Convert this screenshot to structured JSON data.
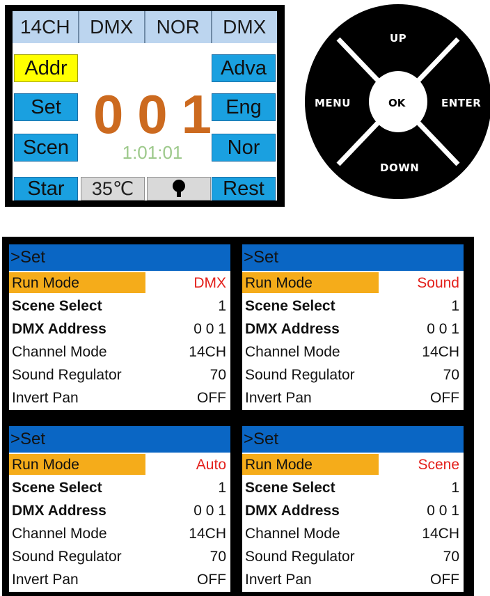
{
  "main_display": {
    "header": [
      "14CH",
      "DMX",
      "NOR",
      "DMX"
    ],
    "left_buttons": [
      "Addr",
      "Set",
      "Scen",
      "Star"
    ],
    "right_buttons": [
      "Adva",
      "Eng",
      "Nor",
      "Rest"
    ],
    "address_digits": [
      "0",
      "0",
      "1"
    ],
    "timer": "1:01:01",
    "temperature": "35℃",
    "lamp_icon": "lamp-icon"
  },
  "dpad": {
    "up": "UP",
    "down": "DOWN",
    "left": "MENU",
    "right": "ENTER",
    "center": "OK"
  },
  "panels": [
    {
      "title": ">Set",
      "rows": [
        {
          "label": "Run Mode",
          "value": "DMX"
        },
        {
          "label": "Scene Select",
          "value": "1"
        },
        {
          "label": "DMX Address",
          "value": "0 0 1"
        },
        {
          "label": "Channel Mode",
          "value": "14CH"
        },
        {
          "label": "Sound Regulator",
          "value": "70"
        },
        {
          "label": "Invert Pan",
          "value": "OFF"
        }
      ]
    },
    {
      "title": ">Set",
      "rows": [
        {
          "label": "Run Mode",
          "value": "Sound"
        },
        {
          "label": "Scene Select",
          "value": "1"
        },
        {
          "label": "DMX Address",
          "value": "0 0 1"
        },
        {
          "label": "Channel Mode",
          "value": "14CH"
        },
        {
          "label": "Sound Regulator",
          "value": "70"
        },
        {
          "label": "Invert Pan",
          "value": "OFF"
        }
      ]
    },
    {
      "title": ">Set",
      "rows": [
        {
          "label": "Run Mode",
          "value": "Auto"
        },
        {
          "label": "Scene Select",
          "value": "1"
        },
        {
          "label": "DMX Address",
          "value": "0 0 1"
        },
        {
          "label": "Channel Mode",
          "value": "14CH"
        },
        {
          "label": "Sound Regulator",
          "value": "70"
        },
        {
          "label": "Invert Pan",
          "value": "OFF"
        }
      ]
    },
    {
      "title": ">Set",
      "rows": [
        {
          "label": "Run Mode",
          "value": "Scene"
        },
        {
          "label": "Scene Select",
          "value": "1"
        },
        {
          "label": "DMX Address",
          "value": "0 0 1"
        },
        {
          "label": "Channel Mode",
          "value": "14CH"
        },
        {
          "label": "Sound Regulator",
          "value": "70"
        },
        {
          "label": "Invert Pan",
          "value": "OFF"
        }
      ]
    }
  ],
  "colors": {
    "button_blue": "#1aa0e0",
    "selected_yellow": "#ffff00",
    "address_orange": "#cc6a1f",
    "timer_green": "#9dc98b",
    "title_blue": "#0a66c4",
    "highlight_orange": "#f5ac1a",
    "value_red": "#e3201b"
  }
}
